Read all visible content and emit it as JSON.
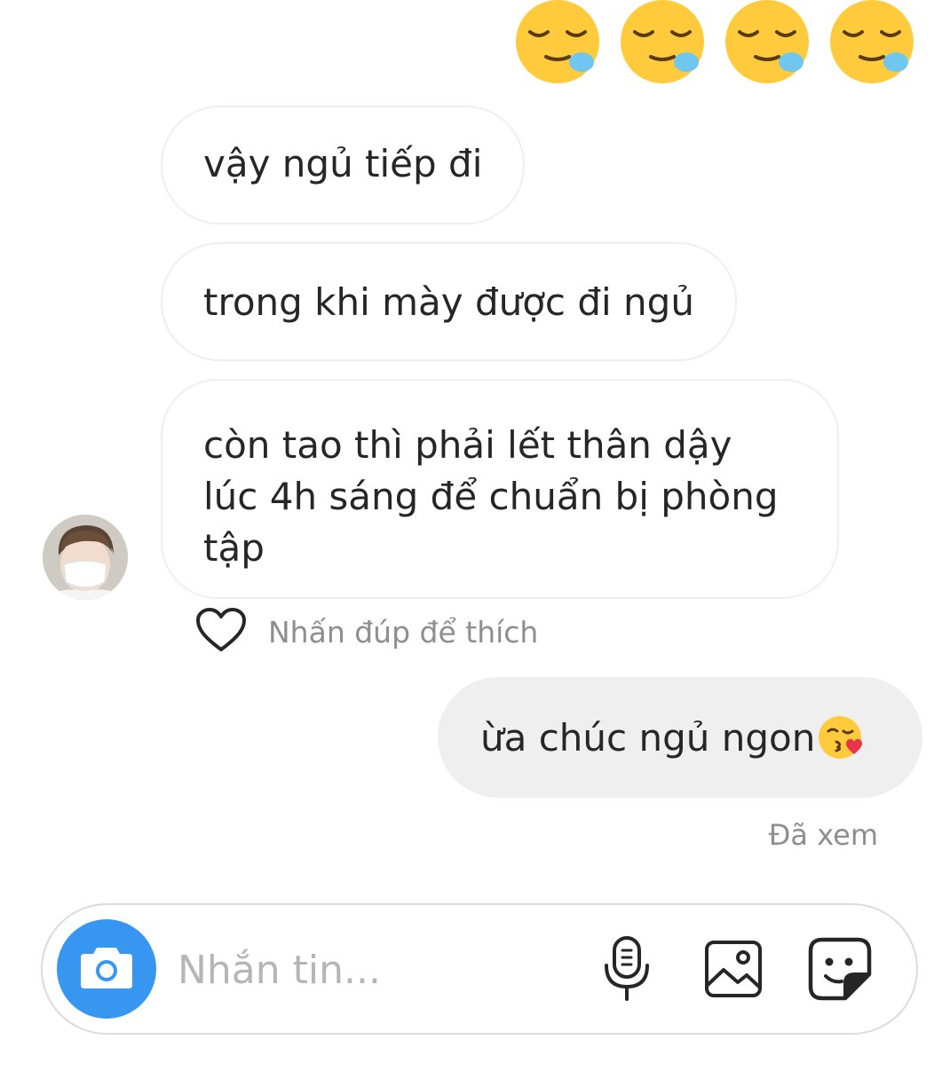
{
  "messages_in": {
    "m1": "vậy ngủ tiếp đi",
    "m2": "trong khi mày được đi ngủ",
    "m3_lines": [
      "còn tao thì phải lết thân dậy",
      "lúc 4h sáng để chuẩn bị phòng",
      "tập"
    ]
  },
  "like_hint": "Nhấn đúp để thích",
  "message_out": "ừa chúc ngủ ngon",
  "seen_status": "Đã xem",
  "composer": {
    "placeholder": "Nhắn tin..."
  },
  "colors": {
    "accent": "#3797f0",
    "bubble_out": "#efefef",
    "bubble_in_border": "#efefef",
    "muted_text": "#8e8e8e"
  },
  "icons": {
    "top_row": [
      "sleepy-face-emoji",
      "sleepy-face-emoji",
      "sleepy-face-emoji",
      "sleepy-face-emoji"
    ],
    "inline": "face-blowing-kiss-emoji",
    "composer": [
      "camera-icon",
      "microphone-icon",
      "gallery-icon",
      "sticker-icon"
    ],
    "like": "heart-icon"
  }
}
